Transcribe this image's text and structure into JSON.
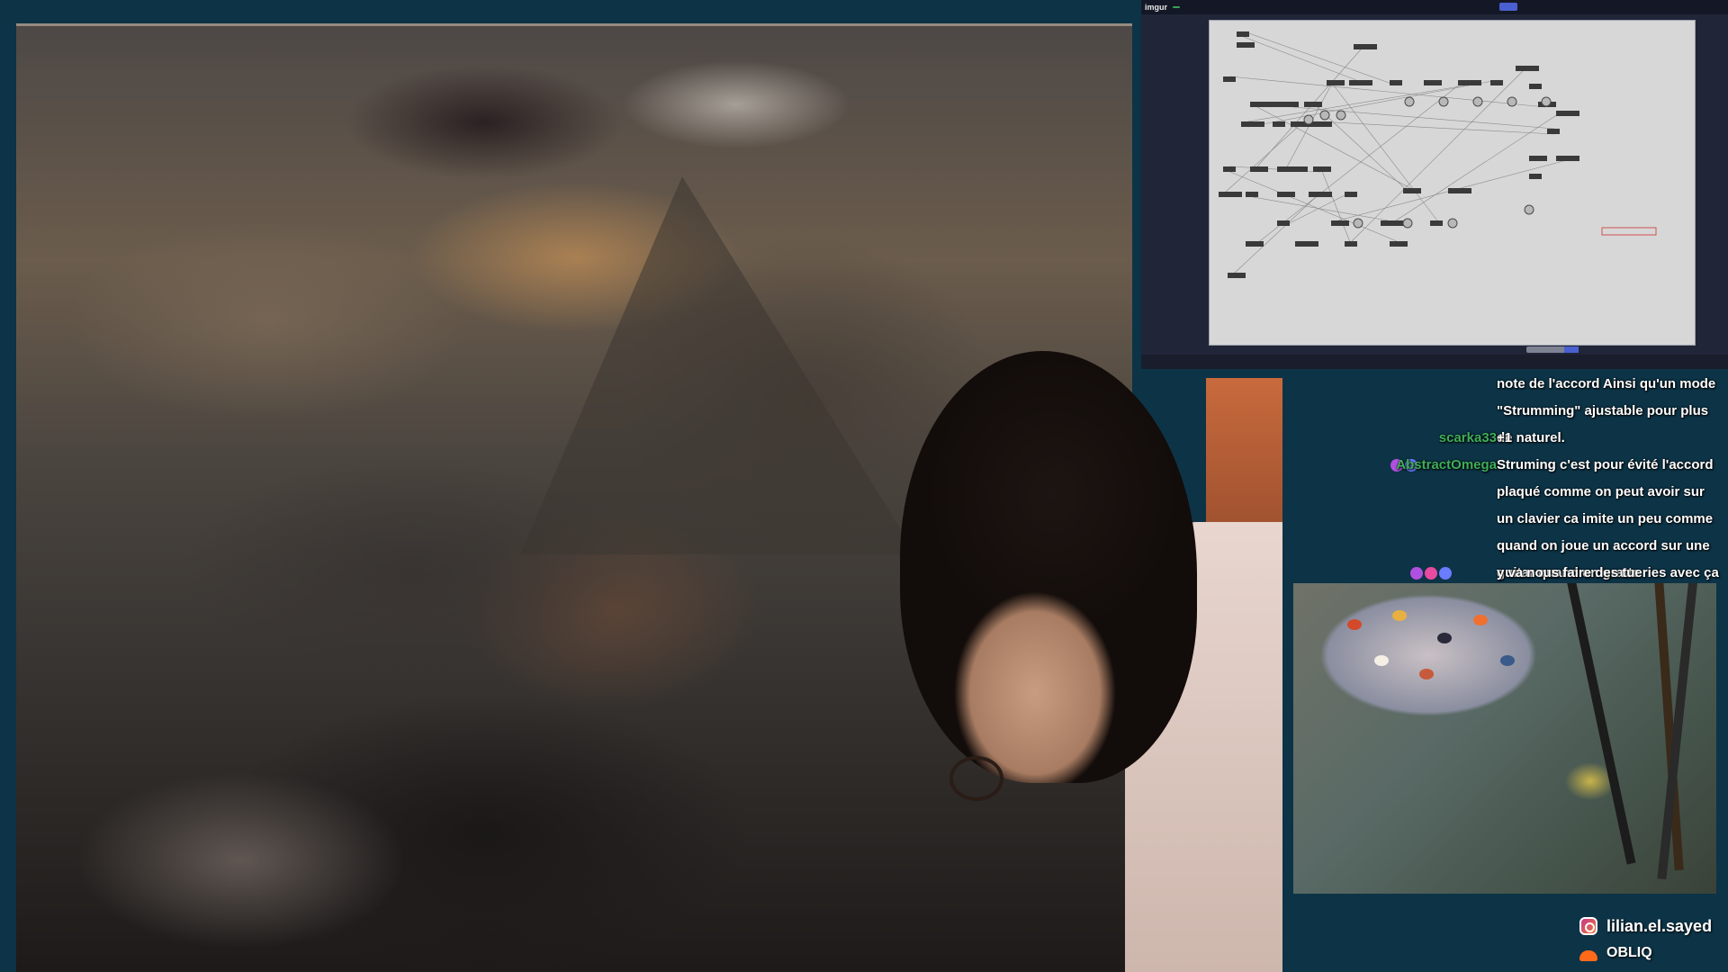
{
  "app_window": {
    "logo": "imgur",
    "badge": "",
    "status_items": [
      "",
      "",
      "",
      "",
      "",
      "",
      "",
      "",
      ""
    ]
  },
  "chat": {
    "messages": [
      {
        "user": "",
        "text": "note de l'accord Ainsi qu'un mode \"Strumming\" ajustable pour plus de naturel.",
        "user_color": "#6bd26b",
        "badges": []
      },
      {
        "user": "scarka33",
        "text": "+1",
        "user_color": "#3fae5a",
        "badges": []
      },
      {
        "user": "AbstractOmega",
        "text": "Struming c'est pour évité l'accord plaqué comme on peut avoir sur un clavier ca imite un peu comme quand on joue un accord sur une guitar quand on gratte",
        "user_color": "#3fae5a",
        "badges": [
          "#b050e0",
          "#6a7cff"
        ]
      },
      {
        "user": "",
        "text": "y va nous faire des tueries avec ça l'@ab",
        "user_color": "#e83a3a",
        "badges": [
          "#b050e0",
          "#e84aa0",
          "#6a7cff"
        ]
      }
    ]
  },
  "socials": {
    "instagram": "lilian.el.sayed",
    "soundcloud": "OBLIQ"
  },
  "colors": {
    "background": "#0d3346",
    "chat_name_green": "#3fae5a",
    "chat_name_red": "#e83a3a"
  }
}
